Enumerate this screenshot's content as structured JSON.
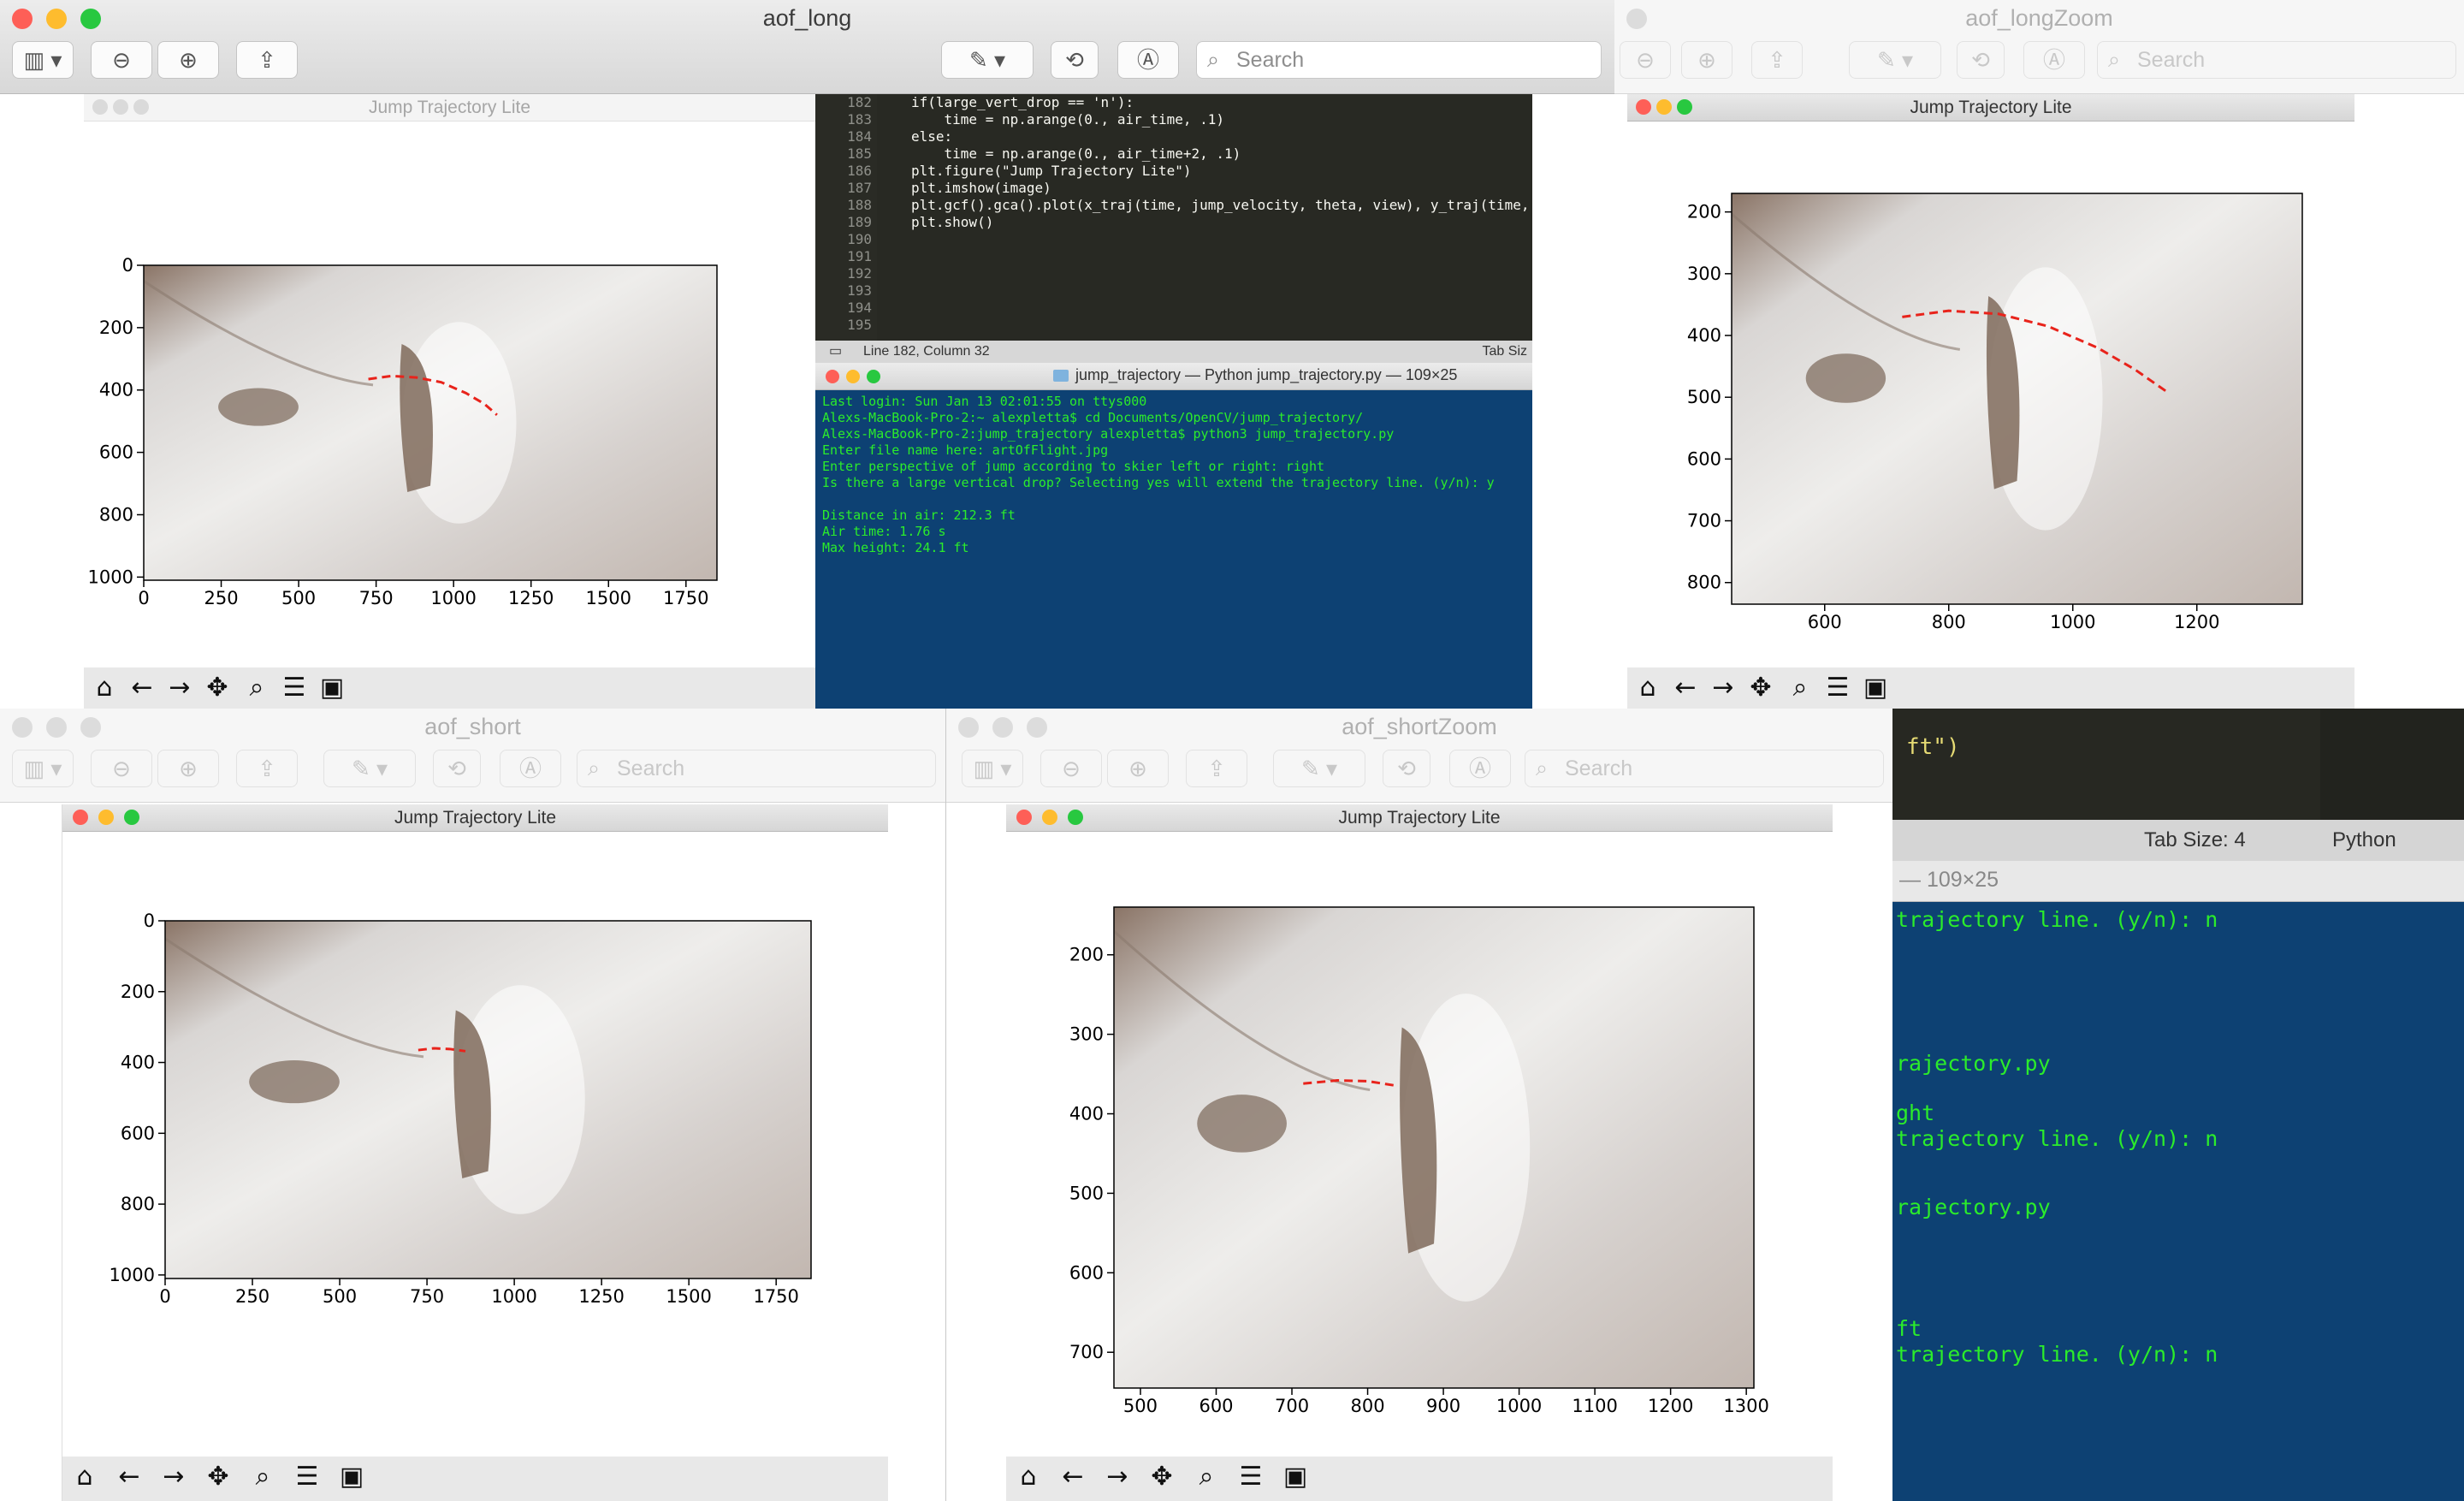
{
  "search_placeholder": "Search",
  "windows": {
    "aof_long": "aof_long",
    "aof_longZoom": "aof_longZoom",
    "aof_short": "aof_short",
    "aof_shortZoom": "aof_shortZoom"
  },
  "figure_title": "Jump Trajectory Lite",
  "editor": {
    "lines": [
      {
        "n": "182",
        "text": "if(large_vert_drop == 'n'):"
      },
      {
        "n": "183",
        "text": "    time = np.arange(0., air_time, .1)"
      },
      {
        "n": "184",
        "text": "else:"
      },
      {
        "n": "185",
        "text": "    time = np.arange(0., air_time+2, .1)"
      },
      {
        "n": "186",
        "text": "plt.figure(\"Jump Trajectory Lite\")"
      },
      {
        "n": "187",
        "text": "plt.imshow(image)"
      },
      {
        "n": "188",
        "text": "plt.gcf().gca().plot(x_traj(time, jump_velocity, theta, view), y_traj(time, j"
      },
      {
        "n": "189",
        "text": "plt.show()"
      },
      {
        "n": "190",
        "text": ""
      },
      {
        "n": "191",
        "text": ""
      },
      {
        "n": "192",
        "text": ""
      },
      {
        "n": "193",
        "text": ""
      },
      {
        "n": "194",
        "text": ""
      },
      {
        "n": "195",
        "text": ""
      }
    ],
    "status_left": "Line 182, Column 32",
    "status_right": "Tab Siz",
    "bg_status_tab": "Tab Size: 4",
    "bg_status_lang": "Python",
    "bg_code_fragment": "ft\")"
  },
  "terminal": {
    "title": "jump_trajectory — Python jump_trajectory.py — 109×25",
    "lines": [
      "Last login: Sun Jan 13 02:01:55 on ttys000",
      "Alexs-MacBook-Pro-2:~ alexpletta$ cd Documents/OpenCV/jump_trajectory/",
      "Alexs-MacBook-Pro-2:jump_trajectory alexpletta$ python3 jump_trajectory.py",
      "Enter file name here: artOfFlight.jpg",
      "Enter perspective of jump according to skier left or right: right",
      "Is there a large vertical drop? Selecting yes will extend the trajectory line. (y/n): y",
      "",
      "Distance in air: 212.3 ft",
      "Air time: 1.76 s",
      "Max height: 24.1 ft"
    ],
    "bg_title_fragment": "— 109×25",
    "bg_lines": [
      {
        "y": 0,
        "text": "trajectory line. (y/n): n"
      },
      {
        "y": 1,
        "text": "rajectory.py"
      },
      {
        "y": 2,
        "text": "ght"
      },
      {
        "y": 3,
        "text": "trajectory line. (y/n): n"
      },
      {
        "y": 4,
        "text": "rajectory.py"
      },
      {
        "y": 5,
        "text": "ft"
      },
      {
        "y": 6,
        "text": "trajectory line. (y/n): n"
      }
    ]
  },
  "chart_data": [
    {
      "type": "scatter",
      "name": "aof_long",
      "x_ticks": [
        "0",
        "250",
        "500",
        "750",
        "1000",
        "1250",
        "1500",
        "1750"
      ],
      "y_ticks": [
        "0",
        "200",
        "400",
        "600",
        "800",
        "1000"
      ],
      "xlim": [
        0,
        1850
      ],
      "ylim": [
        1010,
        0
      ],
      "trajectory": [
        [
          725,
          365
        ],
        [
          800,
          355
        ],
        [
          880,
          360
        ],
        [
          960,
          375
        ],
        [
          1040,
          410
        ],
        [
          1100,
          445
        ],
        [
          1140,
          480
        ]
      ]
    },
    {
      "type": "scatter",
      "name": "aof_longZoom",
      "x_ticks": [
        "600",
        "800",
        "1000",
        "1200"
      ],
      "y_ticks": [
        "200",
        "300",
        "400",
        "500",
        "600",
        "700",
        "800"
      ],
      "xlim": [
        450,
        1370
      ],
      "ylim": [
        835,
        170
      ],
      "trajectory": [
        [
          725,
          370
        ],
        [
          800,
          360
        ],
        [
          880,
          365
        ],
        [
          960,
          385
        ],
        [
          1040,
          420
        ],
        [
          1100,
          455
        ],
        [
          1150,
          490
        ]
      ]
    },
    {
      "type": "scatter",
      "name": "aof_short",
      "x_ticks": [
        "0",
        "250",
        "500",
        "750",
        "1000",
        "1250",
        "1500",
        "1750"
      ],
      "y_ticks": [
        "0",
        "200",
        "400",
        "600",
        "800",
        "1000"
      ],
      "xlim": [
        0,
        1850
      ],
      "ylim": [
        1010,
        0
      ],
      "trajectory": [
        [
          725,
          365
        ],
        [
          770,
          360
        ],
        [
          815,
          362
        ],
        [
          860,
          368
        ]
      ]
    },
    {
      "type": "scatter",
      "name": "aof_shortZoom",
      "x_ticks": [
        "500",
        "600",
        "700",
        "800",
        "900",
        "1000",
        "1100",
        "1200",
        "1300"
      ],
      "y_ticks": [
        "200",
        "300",
        "400",
        "500",
        "600",
        "700"
      ],
      "xlim": [
        465,
        1310
      ],
      "ylim": [
        745,
        140
      ],
      "trajectory": [
        [
          715,
          362
        ],
        [
          760,
          358
        ],
        [
          800,
          359
        ],
        [
          840,
          365
        ]
      ]
    }
  ]
}
